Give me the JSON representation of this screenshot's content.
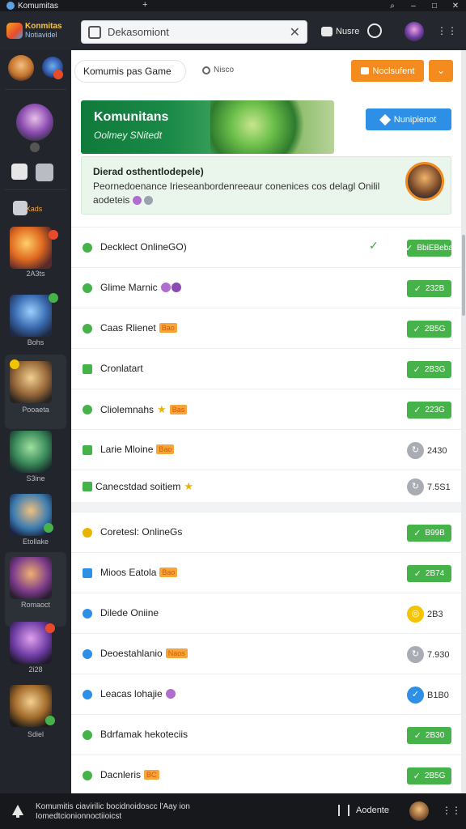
{
  "titlebar": {
    "title": "Komumitas",
    "plus": "+",
    "buttons": [
      "⌕",
      "–",
      "□",
      "✕"
    ]
  },
  "header": {
    "logo_line1": "Konmitas",
    "logo_line2": "Notiavidel",
    "search_value": "Dekasomiont",
    "search_clear": "✕",
    "game_label": "Nusre",
    "more": "⋮⋮"
  },
  "sidebar": {
    "items": [
      {
        "label": "Xads",
        "active": false
      },
      {
        "label": "2A3ts",
        "active": false
      },
      {
        "label": "Bohs",
        "active": false
      },
      {
        "label": "Pooaeta",
        "active": true
      },
      {
        "label": "S3ine",
        "active": false
      },
      {
        "label": "Etollake",
        "active": false
      },
      {
        "label": "Romaoct",
        "active": false
      },
      {
        "label": "2i28",
        "active": false
      },
      {
        "label": "Sdiel",
        "active": false
      }
    ]
  },
  "subheader": {
    "chip": "Komumis pas Game",
    "filter": "Nisco",
    "orange_button": "Noclsufent",
    "orange_dropdown": "⌄"
  },
  "banner": {
    "title": "Komunitans",
    "subtitle": "Oolmey SNitedt",
    "button": "Nunipienot"
  },
  "info_card": {
    "heading": "Dierad osthentlodepele)",
    "line1": "Peornedoenance Irieseanbordenreeaur conenices cos delagl Onilil",
    "line2": "aodeteis"
  },
  "rows_group1": [
    {
      "name": "Decklect OnlineGO)",
      "tag": "",
      "icon_color": "#45b24a",
      "status": "pill",
      "value": "BbiEBeba",
      "extra_check": true
    },
    {
      "name": "Glime Marnic",
      "tag": "",
      "gems": 2,
      "icon_color": "#45b24a",
      "status": "pill",
      "value": "232B"
    },
    {
      "name": "Caas Rlienet",
      "tag": "Bao",
      "icon_color": "#45b24a",
      "status": "pill",
      "value": "2B5G"
    },
    {
      "name": "Cronlatart",
      "tag": "",
      "icon_color": "#45b24a",
      "status": "pill",
      "value": "2B3G"
    },
    {
      "name": "Cliolemnahs",
      "tag": "Bas",
      "star": true,
      "icon_color": "#45b24a",
      "status": "pill",
      "value": "223G"
    },
    {
      "name": "Larie Mloine",
      "tag": "Bao",
      "icon_color": "#45b24a",
      "status": "circle",
      "circle_color": "#a9adb3",
      "value": "2430"
    },
    {
      "name": "Canecstdad soitiem",
      "tag": "",
      "star": true,
      "icon_color": "#45b24a",
      "status": "circle",
      "circle_color": "#a9adb3",
      "value": "7.5S1"
    }
  ],
  "rows_group2": [
    {
      "name": "Coretesl: OnlineGs",
      "tag": "",
      "icon_color": "#e8b400",
      "status": "pill",
      "value": "B99B"
    },
    {
      "name": "Mioos Eatola",
      "tag": "Bao",
      "icon_color": "#2e8fe6",
      "status": "pill",
      "value": "2B74"
    },
    {
      "name": "Dilede Oniine",
      "tag": "",
      "icon_color": "#2e8fe6",
      "status": "circle",
      "circle_color": "#f5c400",
      "value": "2B3"
    },
    {
      "name": "Deoestahlanio",
      "tag": "Naos",
      "icon_color": "#2e8fe6",
      "status": "circle",
      "circle_color": "#a9adb3",
      "value": "7.930"
    },
    {
      "name": "Leacas lohajie",
      "tag": "",
      "gems": 1,
      "icon_color": "#2e8fe6",
      "status": "circle",
      "circle_color": "#2e8fe6",
      "value": "B1B0"
    },
    {
      "name": "Bdrfamak hekoteciis",
      "tag": "",
      "icon_color": "#45b24a",
      "status": "pill",
      "value": "2B30"
    },
    {
      "name": "Dacnleris",
      "tag": "BC",
      "icon_color": "#45b24a",
      "status": "pill",
      "value": "2B5G"
    }
  ],
  "footer": {
    "line1": "Komumitis ciavirilic bocidnoidoscc l'Aay ion",
    "line2": "Iomedtcionionnoctiioicst",
    "button": "Aodente",
    "more": "⋮⋮"
  },
  "colors": {
    "accent_orange": "#f38b1f",
    "accent_blue": "#2e8fe6",
    "status_green": "#45b24a"
  }
}
